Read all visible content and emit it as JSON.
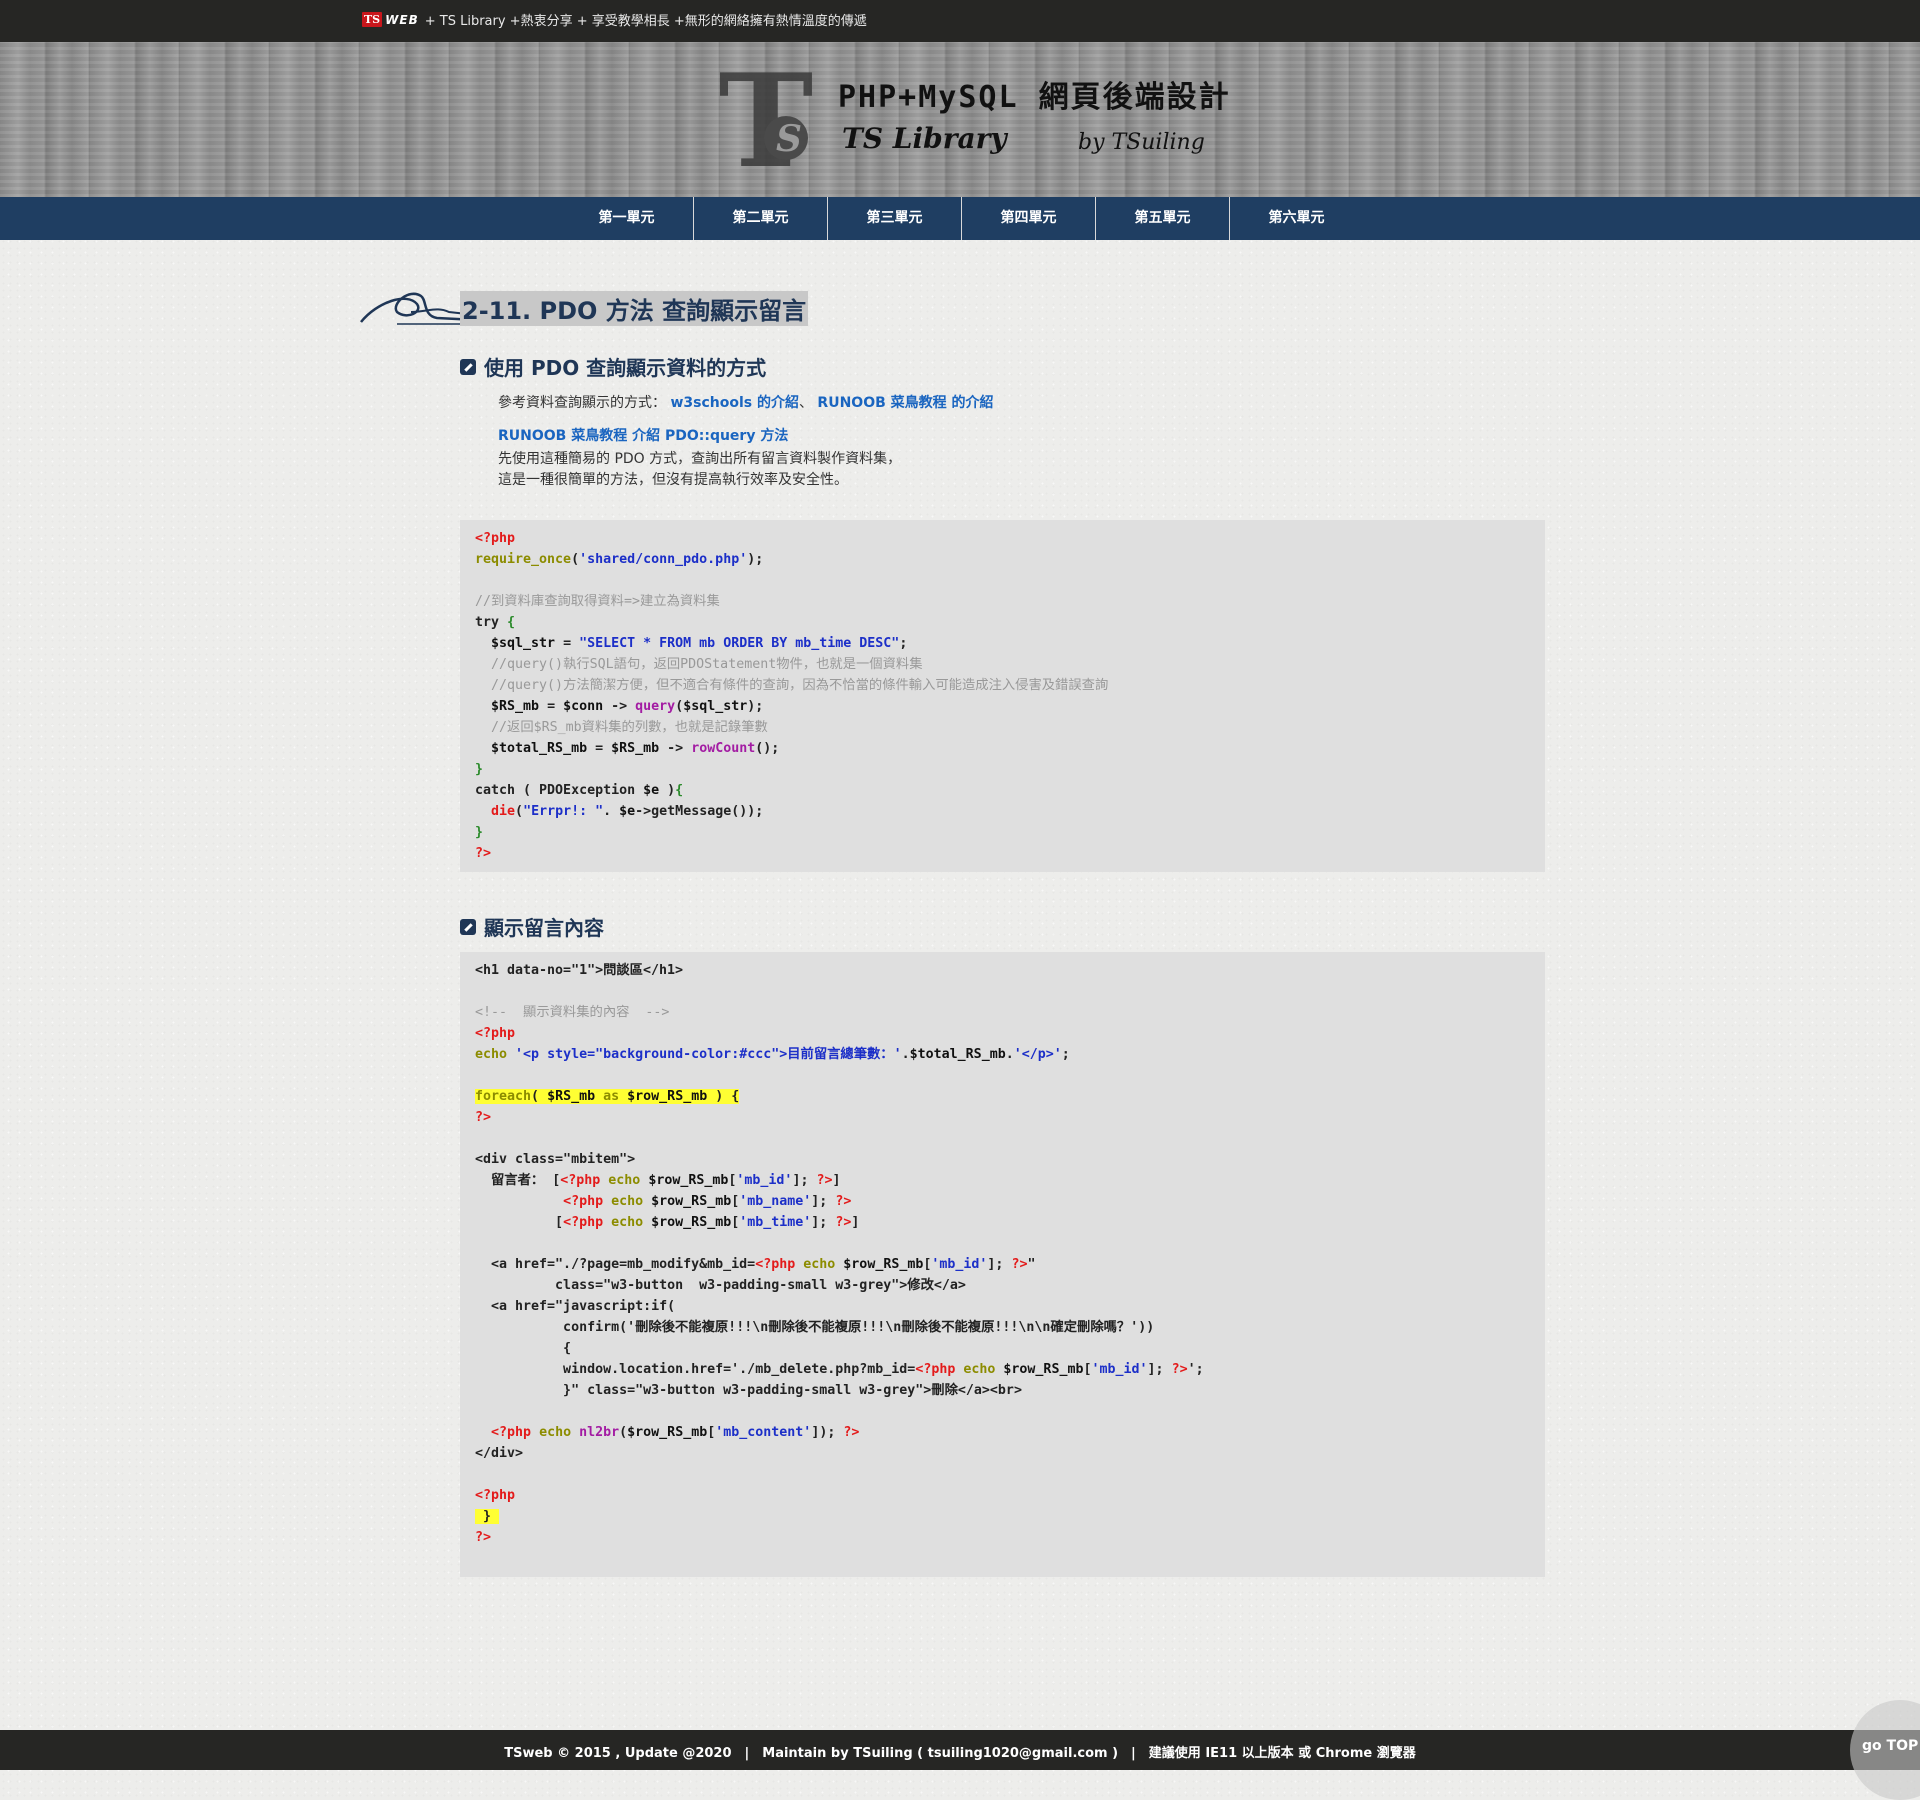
{
  "topbar": {
    "ts": "TS",
    "web": "WEB",
    "text": "+ TS Library +熱衷分享 + 享受教學相長 +無形的網絡擁有熱情溫度的傳遞"
  },
  "banner": {
    "logo_text": "TS",
    "title": "PHP+MySQL 網頁後端設計",
    "subtitle": "TS Library",
    "author": "by TSuiling"
  },
  "nav": {
    "items": [
      "第一單元",
      "第二單元",
      "第三單元",
      "第四單元",
      "第五單元",
      "第六單元"
    ]
  },
  "page_title": "2-11. PDO 方法 查詢顯示留言",
  "section1": {
    "heading": "使用 PDO 查詢顯示資料的方式",
    "ref_prefix": "參考資料查詢顯示的方式：",
    "link1": "w3schools 的介紹",
    "sep": "、",
    "link2": "RUNOOB 菜鳥教程 的介紹",
    "link3": "RUNOOB 菜鳥教程 介紹 PDO::query 方法",
    "desc1": "先使用這種簡易的 PDO 方式，查詢出所有留言資料製作資料集，",
    "desc2": "這是一種很簡單的方法，但沒有提高執行效率及安全性。"
  },
  "section2": {
    "heading": "顯示留言內容"
  },
  "footer": {
    "text": "TSweb © 2015 , Update @2020　|　Maintain by TSuiling ( tsuiling1020@gmail.com )　|　建議使用 IE11 以上版本 或 Chrome 瀏覽器"
  },
  "gotop": "go TOP",
  "colors": {
    "nav_bg": "#1f3e62",
    "topbar_bg": "#262624",
    "heading": "#1f3656",
    "link": "#1a65c0",
    "highlight": "#ffff33"
  }
}
